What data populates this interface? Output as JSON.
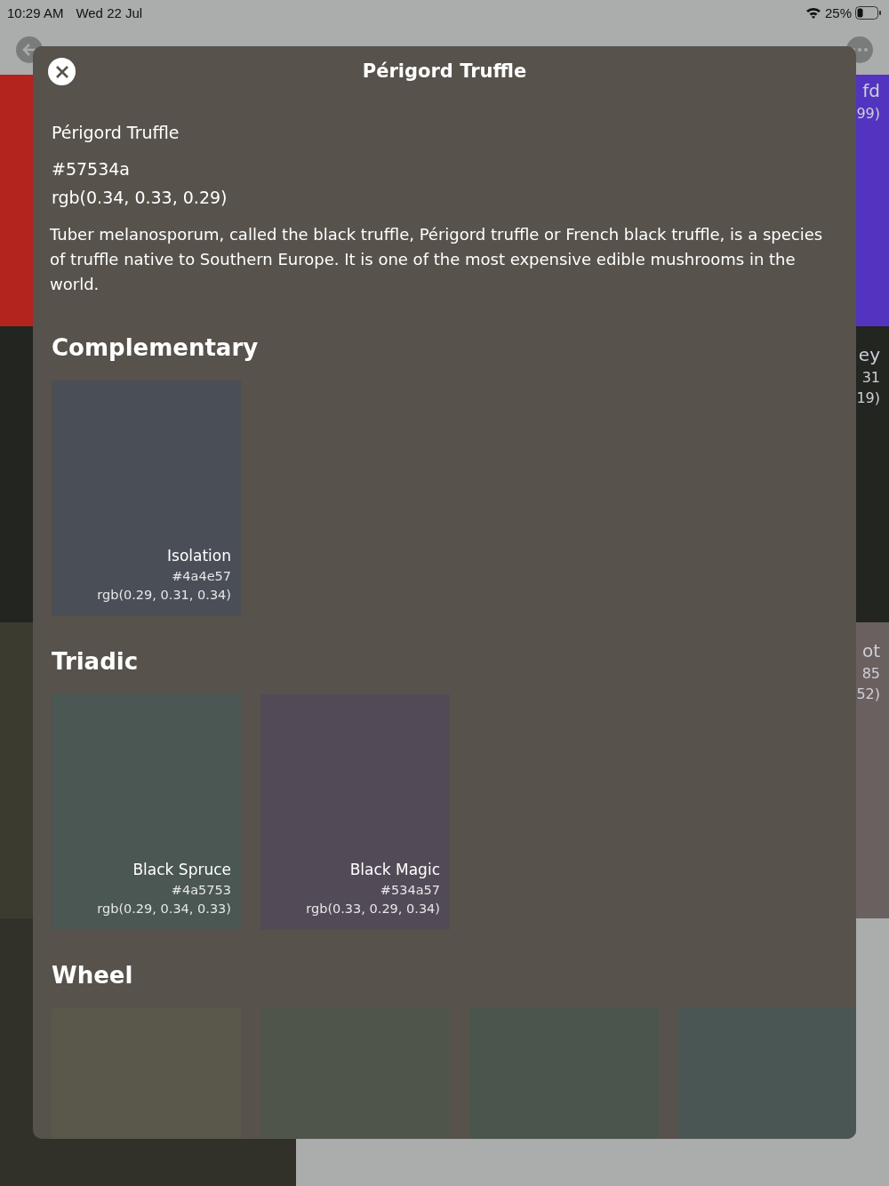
{
  "status_bar": {
    "time": "10:29 AM",
    "date": "Wed 22 Jul",
    "battery": "25%"
  },
  "background": {
    "tiles": [
      {
        "kind": "colour",
        "color": "#b2241d"
      },
      {
        "kind": "empty"
      },
      {
        "kind": "colour",
        "color": "#5334c0",
        "texts": [
          "fd",
          "99)"
        ]
      },
      {
        "kind": "colour",
        "color": "#222520"
      },
      {
        "kind": "empty"
      },
      {
        "kind": "colour",
        "color": "#222520",
        "texts": [
          "ey",
          "31",
          "19)"
        ]
      },
      {
        "kind": "colour",
        "color": "#3b3b2f"
      },
      {
        "kind": "empty"
      },
      {
        "kind": "colour",
        "color": "#6b6060",
        "texts": [
          "ot",
          "85",
          "52)"
        ]
      },
      {
        "kind": "colour",
        "color": "#31312a"
      },
      {
        "kind": "empty"
      },
      {
        "kind": "empty"
      }
    ]
  },
  "modal": {
    "title": "Périgord Truffle",
    "name": "Périgord Truffle",
    "hex": "#57534a",
    "rgb": "rgb(0.34, 0.33, 0.29)",
    "description": "Tuber melanosporum, called the black truffle, Périgord truffle or French black truffle, is a species of truffle native to Southern Europe. It is one of the most expensive edible mushrooms in the world.",
    "sections": [
      {
        "title": "Complementary",
        "swatches": [
          {
            "name": "Isolation",
            "hex": "#4a4e57",
            "rgb": "rgb(0.29, 0.31, 0.34)",
            "color": "#4a4e57"
          }
        ]
      },
      {
        "title": "Triadic",
        "swatches": [
          {
            "name": "Black Spruce",
            "hex": "#4a5753",
            "rgb": "rgb(0.29, 0.34, 0.33)",
            "color": "#4a5753"
          },
          {
            "name": "Black Magic",
            "hex": "#534a57",
            "rgb": "rgb(0.33, 0.29, 0.34)",
            "color": "#534a57"
          }
        ]
      },
      {
        "title": "Wheel",
        "swatches": [
          {
            "color": "#59584a"
          },
          {
            "color": "#4f5649"
          },
          {
            "color": "#4a564d"
          },
          {
            "color": "#4a5653"
          }
        ]
      }
    ]
  }
}
